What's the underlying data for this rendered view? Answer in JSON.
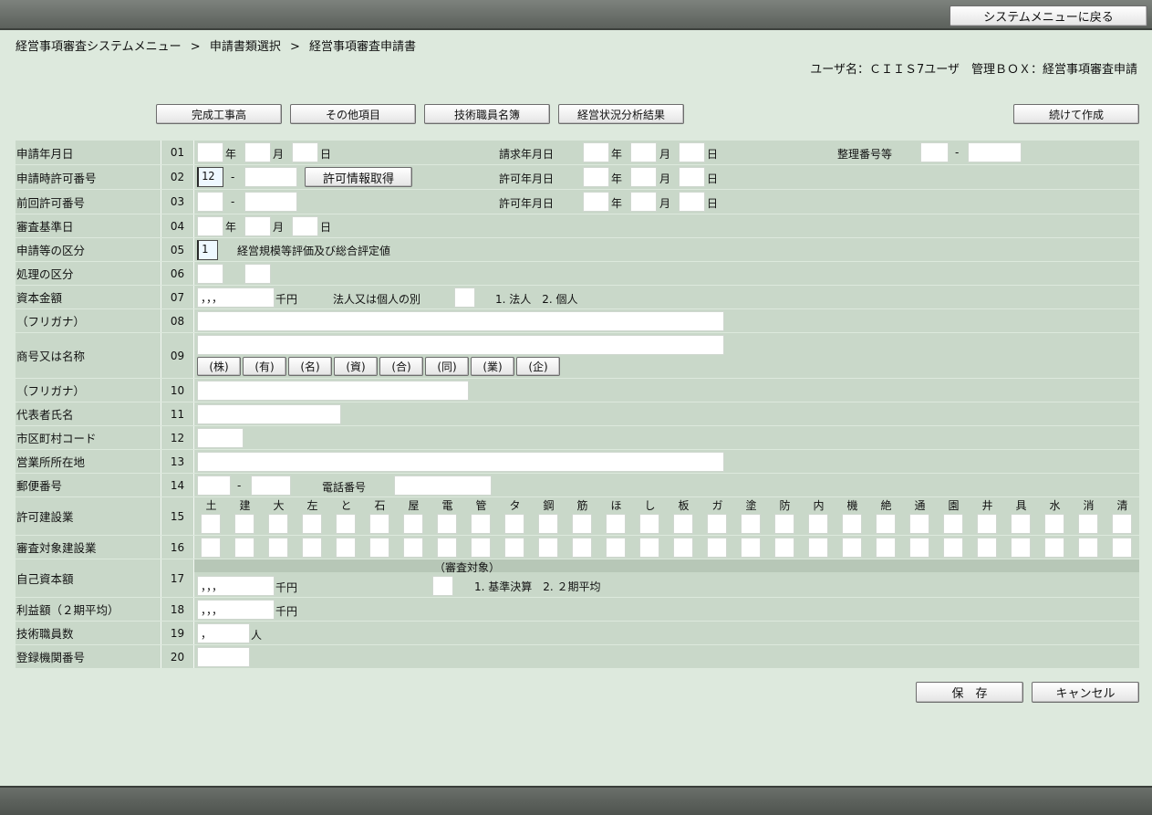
{
  "header": {
    "system_menu_button": "システムメニューに戻る"
  },
  "breadcrumb": {
    "item1": "経営事項審査システムメニュー",
    "sep": ">",
    "item2": "申請書類選択",
    "item3": "経営事項審査申請書"
  },
  "user_info": "ユーザ名：ＣＩＩＳ7ユーザ　管理ＢＯＸ：経営事項審査申請",
  "toolbar": {
    "completion": "完成工事高",
    "other": "その他項目",
    "engineers": "技術職員名簿",
    "analysis": "経営状況分析結果",
    "continue": "続けて作成"
  },
  "units": {
    "year": "年",
    "month": "月",
    "day": "日",
    "dash": "-",
    "thousand_yen": "千円",
    "person": "人"
  },
  "rows": {
    "r01": {
      "label": "申請年月日",
      "num": "01"
    },
    "r02": {
      "label": "申請時許可番号",
      "num": "02"
    },
    "r03": {
      "label": "前回許可番号",
      "num": "03"
    },
    "r04": {
      "label": "審査基準日",
      "num": "04"
    },
    "r05": {
      "label": "申請等の区分",
      "num": "05"
    },
    "r06": {
      "label": "処理の区分",
      "num": "06"
    },
    "r07": {
      "label": "資本金額",
      "num": "07"
    },
    "r08": {
      "label": "（フリガナ）",
      "num": "08"
    },
    "r09": {
      "label": "商号又は名称",
      "num": "09"
    },
    "r10": {
      "label": "（フリガナ）",
      "num": "10"
    },
    "r11": {
      "label": "代表者氏名",
      "num": "11"
    },
    "r12": {
      "label": "市区町村コード",
      "num": "12"
    },
    "r13": {
      "label": "営業所所在地",
      "num": "13"
    },
    "r14": {
      "label": "郵便番号",
      "num": "14"
    },
    "r15": {
      "label": "許可建設業",
      "num": "15"
    },
    "r16": {
      "label": "審査対象建設業",
      "num": "16"
    },
    "r17": {
      "label": "自己資本額",
      "num": "17"
    },
    "r18": {
      "label": "利益額（２期平均）",
      "num": "18"
    },
    "r19": {
      "label": "技術職員数",
      "num": "19"
    },
    "r20": {
      "label": "登録機関番号",
      "num": "20"
    }
  },
  "fields": {
    "billing_date_label": "請求年月日",
    "ref_no_label": "整理番号等",
    "permit_no_prefix": "12",
    "get_permit_button": "許可情報取得",
    "permit_date_label": "許可年月日",
    "prev_permit_date_label": "許可年月日",
    "app_type_value": "1",
    "app_type_desc": "経営規模等評価及び総合評定値",
    "capital_value": "，，，",
    "corp_type_label": "法人又は個人の別",
    "corp_type_options": "1. 法人　2. 個人",
    "phone_label": "電話番号",
    "review_target_label": "（審査対象）",
    "equity_value": "，，，",
    "equity_options": "1. 基準決算　2. ２期平均",
    "profit_value": "，，，",
    "engineers_value": "，"
  },
  "corp_buttons": [
    "(株)",
    "(有)",
    "(名)",
    "(資)",
    "(合)",
    "(同)",
    "(業)",
    "(企)"
  ],
  "industries": [
    "土",
    "建",
    "大",
    "左",
    "と",
    "石",
    "屋",
    "電",
    "管",
    "タ",
    "鋼",
    "筋",
    "ほ",
    "し",
    "板",
    "ガ",
    "塗",
    "防",
    "内",
    "機",
    "絶",
    "通",
    "園",
    "井",
    "具",
    "水",
    "消",
    "清"
  ],
  "footer": {
    "save": "保　存",
    "cancel": "キャンセル"
  }
}
